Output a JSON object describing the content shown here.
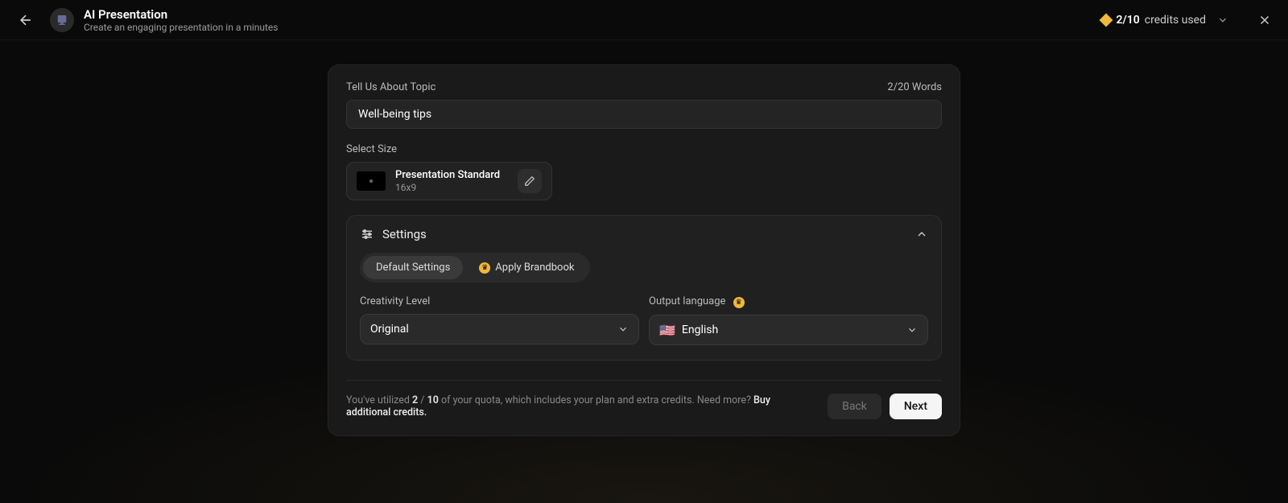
{
  "header": {
    "title": "AI Presentation",
    "subtitle": "Create an engaging presentation in a minutes",
    "credits_used": "2/10",
    "credits_label": "credits used"
  },
  "topic": {
    "label": "Tell Us About Topic",
    "word_count": "2/20 Words",
    "value": "Well-being tips"
  },
  "size": {
    "label": "Select Size",
    "name": "Presentation Standard",
    "aspect": "16x9"
  },
  "settings": {
    "title": "Settings",
    "tab_default": "Default Settings",
    "tab_brandbook": "Apply Brandbook",
    "creativity_label": "Creativity Level",
    "creativity_value": "Original",
    "language_label": "Output language",
    "language_flag": "🇺🇸",
    "language_value": "English"
  },
  "footer": {
    "quota_pre": "You've utilized ",
    "quota_used": "2",
    "quota_sep": " / ",
    "quota_total": "10",
    "quota_post": " of your quota, which includes your plan and extra credits. Need more? ",
    "buy_link": "Buy additional credits.",
    "back": "Back",
    "next": "Next"
  }
}
